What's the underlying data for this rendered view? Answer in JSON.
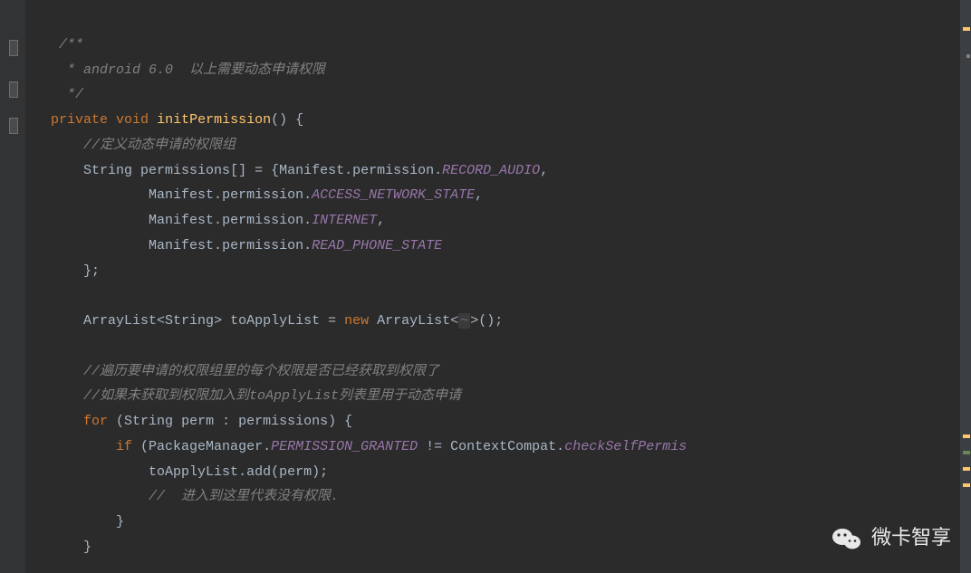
{
  "code": {
    "doc1": "/**",
    "doc2": " * android 6.0  以上需要动态申请权限",
    "doc3": " */",
    "kw_private": "private",
    "kw_void": "void",
    "method": "initPermission",
    "paren_open": "() {",
    "cm_perm_group": "//定义动态申请的权限组",
    "type_string": "String",
    "perm_var": "permissions",
    "brackets": "[] = {",
    "manifest": "Manifest",
    "permission_word": "permission",
    "const_record": "RECORD_AUDIO",
    "const_network": "ACCESS_NETWORK_STATE",
    "const_internet": "INTERNET",
    "const_readphone": "READ_PHONE_STATE",
    "brace_end_semi": "};",
    "type_arraylist": "ArrayList",
    "lt": "<",
    "gt": ">",
    "toapply": "toApplyList",
    "eq": " = ",
    "kw_new": "new",
    "hint": "~",
    "empty_paren": "();",
    "cm_traverse": "//遍历要申请的权限组里的每个权限是否已经获取到权限了",
    "cm_ifnot": "//如果未获取到权限加入到toApplyList列表里用于动态申请",
    "kw_for": "for",
    "for_open": " (",
    "perm_item": "perm",
    "colon": " : ",
    "for_close": ") {",
    "kw_if": "if",
    "pkg_mgr": "PackageManager",
    "const_granted": "PERMISSION_GRANTED",
    "ne": " != ",
    "ctxcompat": "ContextCompat",
    "check_method": "checkSelfPermis",
    "add_call": ".add(perm);",
    "cm_noperm": "//  进入到这里代表没有权限.",
    "brace_close": "}"
  },
  "watermark": {
    "text": "微卡智享"
  }
}
